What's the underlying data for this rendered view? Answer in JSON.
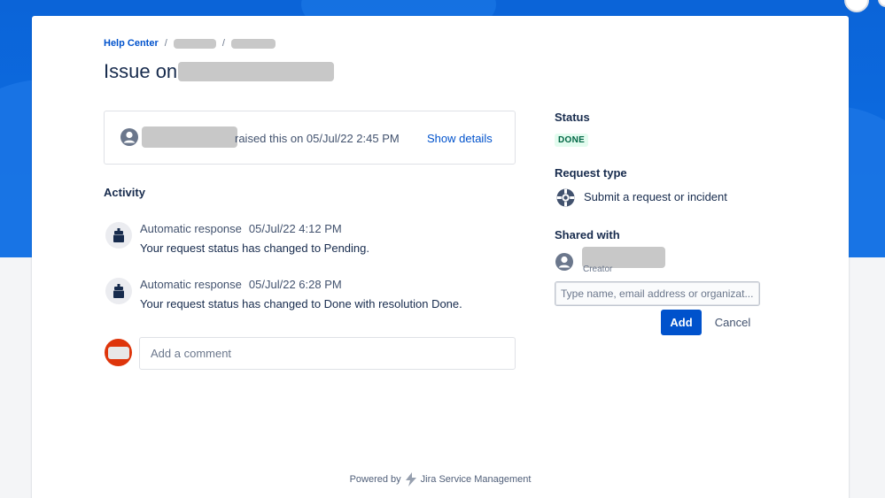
{
  "breadcrumb": {
    "root": "Help Center",
    "separator": "/"
  },
  "issue": {
    "title_prefix": "Issue on",
    "raised_text": "raised this on 05/Jul/22 2:45 PM",
    "show_details": "Show details"
  },
  "activity": {
    "title": "Activity",
    "items": [
      {
        "author": "Automatic response",
        "time": "05/Jul/22 4:12 PM",
        "message": "Your request status has changed to Pending."
      },
      {
        "author": "Automatic response",
        "time": "05/Jul/22 6:28 PM",
        "message": "Your request status has changed to Done with resolution Done."
      }
    ],
    "comment_placeholder": "Add a comment"
  },
  "sidebar": {
    "status_label": "Status",
    "status_value": "DONE",
    "request_type_label": "Request type",
    "request_type_value": "Submit a request or incident",
    "shared_with_label": "Shared with",
    "shared_role": "Creator",
    "share_placeholder": "Type name, email address or organizat...",
    "add_label": "Add",
    "cancel_label": "Cancel"
  },
  "footer": {
    "powered_by": "Powered by",
    "product": "Jira Service Management"
  },
  "colors": {
    "banner": "#0c6be0",
    "primary": "#0052cc",
    "done_text": "#006644",
    "done_bg": "#e3fcef",
    "comment_avatar": "#de350b"
  }
}
